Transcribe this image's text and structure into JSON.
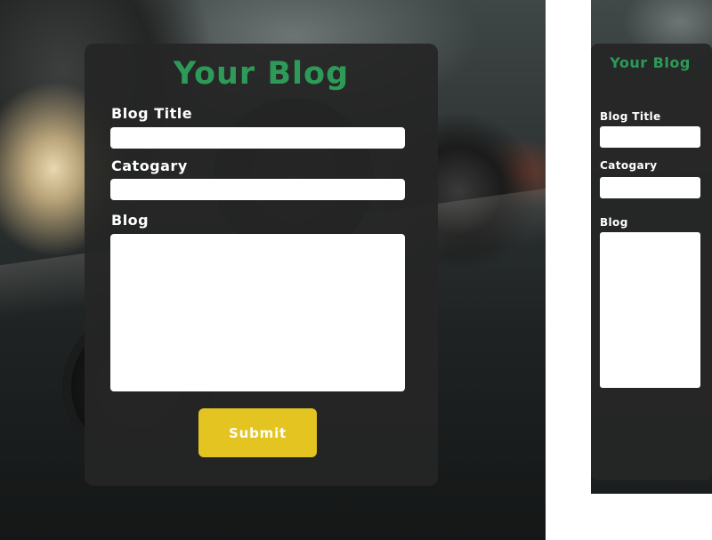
{
  "desktop": {
    "title": "Your Blog",
    "fields": {
      "blog_title_label": "Blog Title",
      "category_label": "Catogary",
      "blog_label": "Blog"
    },
    "submit_label": "Submit"
  },
  "mobile": {
    "title": "Your Blog",
    "fields": {
      "blog_title_label": "Blog Title",
      "category_label": "Catogary",
      "blog_label": "Blog"
    }
  },
  "colors": {
    "title_green": "#2e9a57",
    "submit_yellow": "#e3c420",
    "card_bg": "#252625"
  }
}
